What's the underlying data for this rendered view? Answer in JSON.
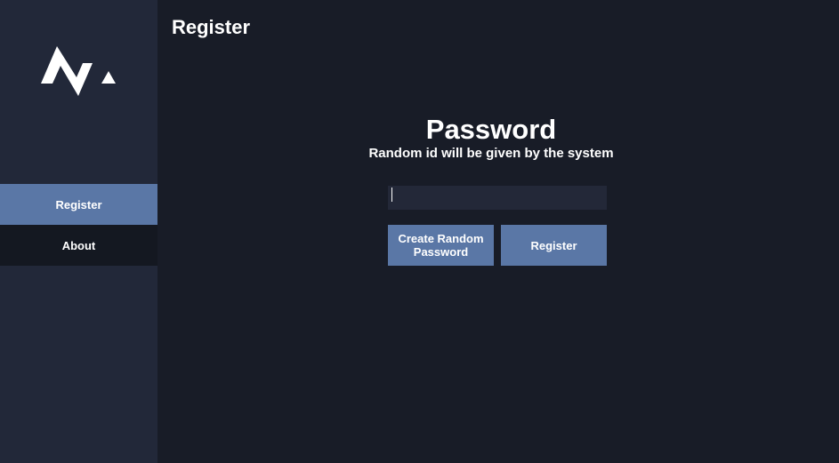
{
  "app": {
    "logo_icon": "brand-logo-icon"
  },
  "sidebar": {
    "items": [
      {
        "label": "Register",
        "active": true
      },
      {
        "label": "About",
        "active": false
      }
    ]
  },
  "header": {
    "title": "Register"
  },
  "form": {
    "heading": "Password",
    "subheading": "Random id will be given by the system",
    "password_value": "",
    "create_random_label": "Create Random Password",
    "register_label": "Register"
  },
  "colors": {
    "sidebar_bg": "#222839",
    "main_bg": "#181c27",
    "accent": "#5a77a6",
    "nav_inactive_bg": "#141821",
    "input_bg": "#232838"
  }
}
